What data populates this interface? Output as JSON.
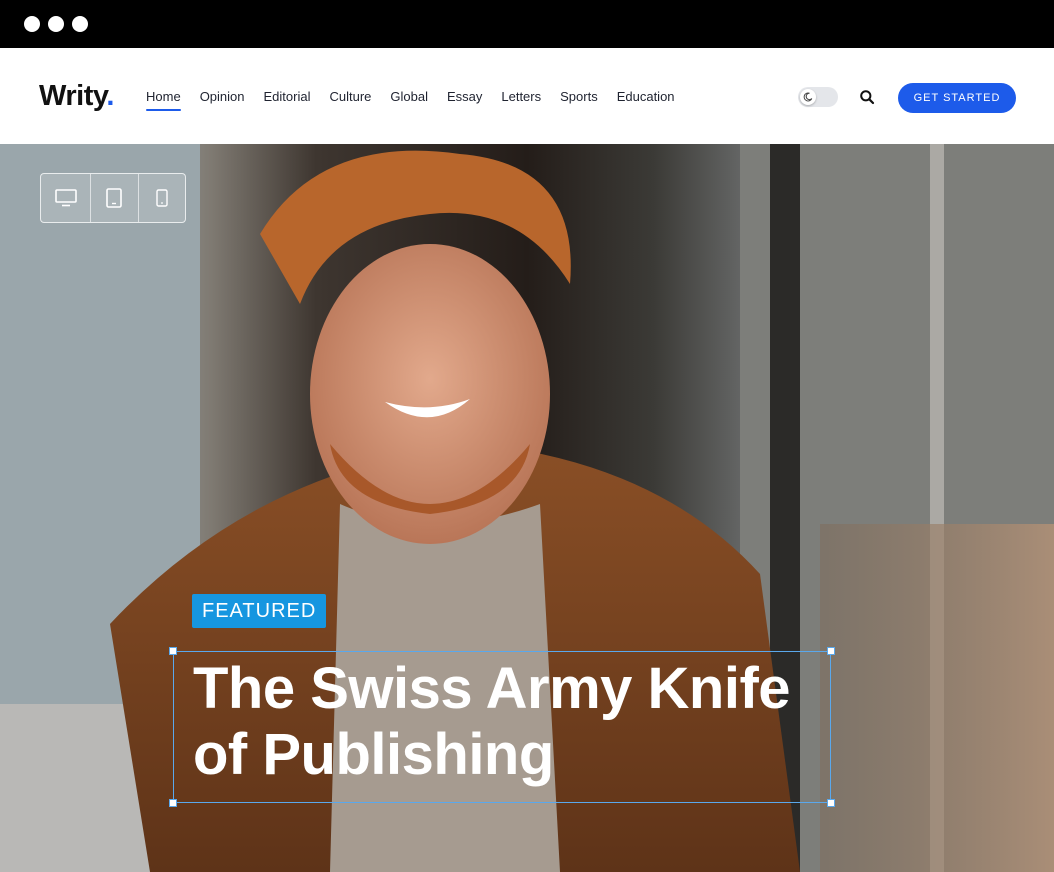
{
  "browser": {
    "window_controls": [
      "dot",
      "dot",
      "dot"
    ]
  },
  "header": {
    "logo_text": "Writy",
    "logo_dot": ".",
    "nav": [
      {
        "label": "Home",
        "active": true
      },
      {
        "label": "Opinion"
      },
      {
        "label": "Editorial"
      },
      {
        "label": "Culture"
      },
      {
        "label": "Global"
      },
      {
        "label": "Essay"
      },
      {
        "label": "Letters"
      },
      {
        "label": "Sports"
      },
      {
        "label": "Education"
      }
    ],
    "theme_toggle_icon": "moon-icon",
    "search_icon": "search-icon",
    "cta_label": "GET STARTED"
  },
  "hero": {
    "device_switcher": [
      "desktop-icon",
      "tablet-icon",
      "mobile-icon"
    ],
    "badge": "FEATURED",
    "title_line1": "The Swiss Army Knife",
    "title_line2": "of Publishing"
  },
  "colors": {
    "accent": "#1d5bea",
    "badge": "#1696e0",
    "selection": "#5aa8ec"
  }
}
